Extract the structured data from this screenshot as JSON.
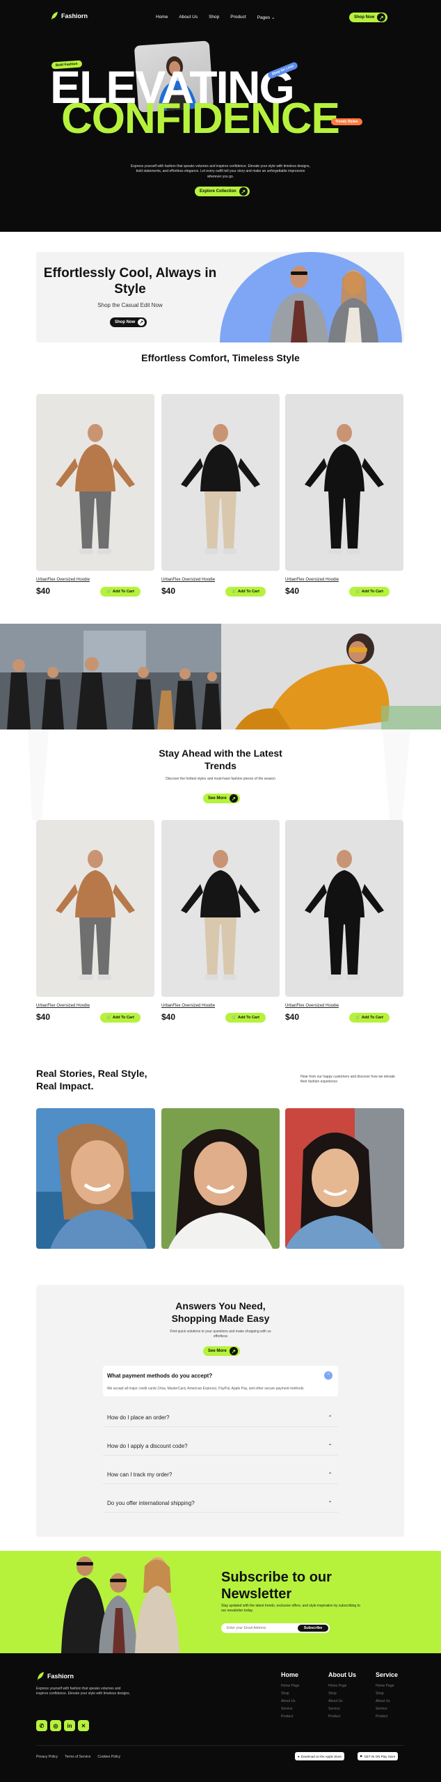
{
  "nav": {
    "brand": "Fashiorn",
    "links": [
      "Home",
      "About Us",
      "Shop",
      "Product",
      "Pages"
    ],
    "pages_chevron": "chevron-down-icon",
    "cta": "Shop Now"
  },
  "hero": {
    "line1": "ELEVATING",
    "line2": "CONFIDENCE",
    "tag_top_left": "Bold Fashion",
    "tag_top_right": "Shop for Less",
    "tag_bottom_right": "Trendy Styles",
    "description": "Express yourself with fashion that speaks volumes and inspires confidence. Elevate your style with timeless designs, bold statements, and effortless elegance. Let every outfit tell your story and make an unforgettable impression wherever you go.",
    "cta": "Explore Collection"
  },
  "promo": {
    "title": "Effortlessly Cool, Always in Style",
    "subtitle": "Shop the Casual Edit Now",
    "cta": "Shop Now"
  },
  "collection1": {
    "title": "Effortless Comfort, Timeless Style",
    "products": [
      {
        "name": "UrbanFlex Oversized Hoodie",
        "price": "$40",
        "button": "Add To Cart"
      },
      {
        "name": "UrbanFlex Oversized Hoodie",
        "price": "$40",
        "button": "Add To Cart"
      },
      {
        "name": "UrbanFlex Oversized Hoodie",
        "price": "$40",
        "button": "Add To Cart"
      }
    ]
  },
  "trends": {
    "title": "Stay Ahead with the Latest Trends",
    "description": "Discover the hottest styles and must-have fashion pieces of the season",
    "cta": "See More"
  },
  "collection2": {
    "products": [
      {
        "name": "UrbanFlex Oversized Hoodie",
        "price": "$40",
        "button": "Add To Cart"
      },
      {
        "name": "UrbanFlex Oversized Hoodie",
        "price": "$40",
        "button": "Add To Cart"
      },
      {
        "name": "UrbanFlex Oversized Hoodie",
        "price": "$40",
        "button": "Add To Cart"
      }
    ]
  },
  "testimonials": {
    "title": "Real Stories, Real Style, Real Impact.",
    "description": "Hear from our happy customers and discover how we elevate their fashion experience"
  },
  "faq": {
    "title": "Answers You Need, Shopping Made Easy",
    "description": "Find quick solutions to your questions and make shopping with us effortless",
    "cta": "See More",
    "open_question": "What payment methods do you accept?",
    "open_answer": "We accept all major credit cards (Visa, MasterCard, American Express), PayPal, Apple Pay, and other secure payment methods.",
    "questions": [
      "How do I place an order?",
      "How do I apply a discount code?",
      "How can I track my order?",
      "Do you offer international shipping?"
    ]
  },
  "newsletter": {
    "title": "Subscribe to our Newsletter",
    "description": "Stay updated with the latest trends, exclusive offers, and style inspiration by subscribing to our newsletter today.",
    "placeholder": "Enter your Email Address",
    "button": "Subscribe"
  },
  "footer": {
    "brand": "Fashiorn",
    "description": "Express yourself with fashion that speaks volumes and inspires confidence. Elevate your style with timeless designs.",
    "columns": [
      {
        "title": "Home",
        "links": [
          "Home Page",
          "Shop",
          "About Us",
          "Service",
          "Product"
        ]
      },
      {
        "title": "About Us",
        "links": [
          "Home Page",
          "Shop",
          "About Us",
          "Service",
          "Product"
        ]
      },
      {
        "title": "Service",
        "links": [
          "Home Page",
          "Shop",
          "About Us",
          "Service",
          "Product"
        ]
      }
    ],
    "socials": [
      "whatsapp-icon",
      "instagram-icon",
      "linkedin-icon",
      "x-icon"
    ],
    "legal": [
      "Privacy Policy",
      "Terms of Service",
      "Cookies Policy"
    ],
    "apple_store": "Download on the Apple Store",
    "play_store": "GET IN ON Play Store"
  },
  "colors": {
    "accent": "#b6f23c",
    "dark": "#0b0b0b",
    "blue": "#7fa6f5"
  }
}
